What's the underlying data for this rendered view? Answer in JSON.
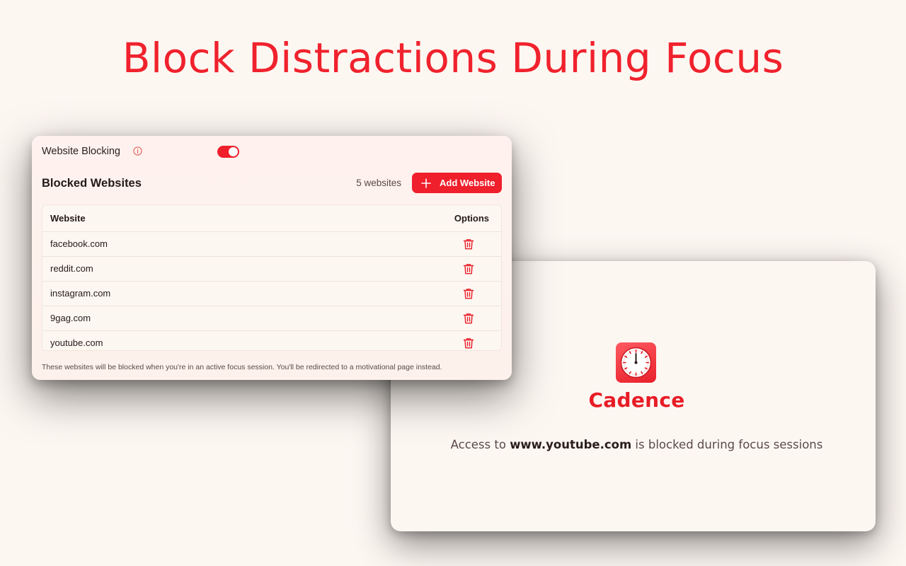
{
  "headline": "Block Distractions During Focus",
  "settings": {
    "toggle_label": "Website Blocking",
    "toggle_on": true,
    "section_title": "Blocked Websites",
    "count_text": "5 websites",
    "add_button_label": "Add Website",
    "table": {
      "columns": [
        "Website",
        "Options"
      ],
      "rows": [
        "facebook.com",
        "reddit.com",
        "instagram.com",
        "9gag.com",
        "youtube.com"
      ]
    },
    "footnote": "These websites will be blocked when you're in an active focus session. You'll be redirected to a motivational page instead."
  },
  "blocked_page": {
    "app_name": "Cadence",
    "message_prefix": "Access to ",
    "blocked_url": "www.youtube.com",
    "message_suffix": " is blocked during focus sessions"
  },
  "colors": {
    "accent": "#ef1f2b",
    "background": "#fdf7f2"
  },
  "icons": [
    "info-icon",
    "plus-icon",
    "trash-icon",
    "clock-icon"
  ]
}
